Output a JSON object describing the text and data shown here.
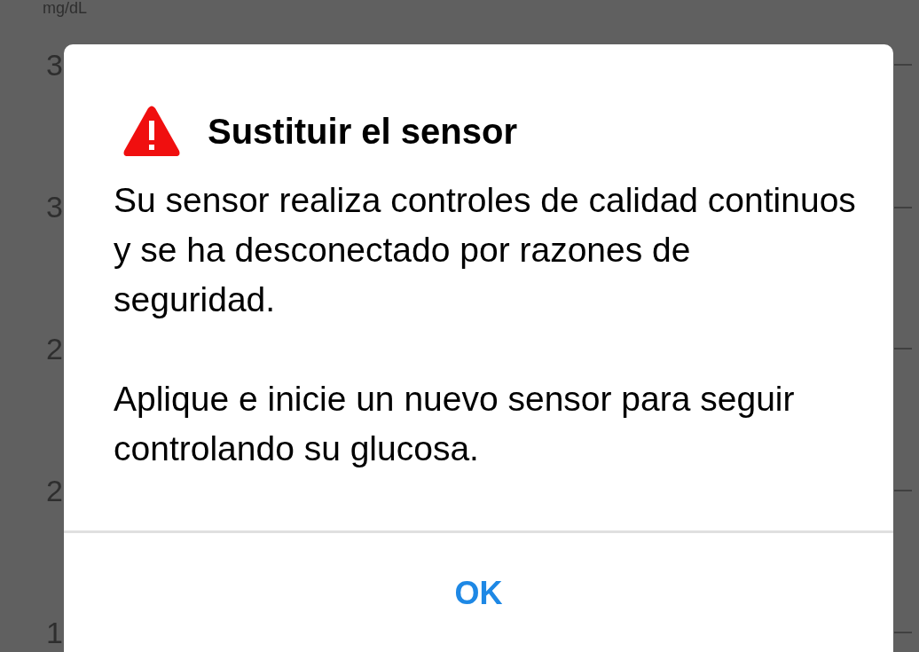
{
  "chart_background": {
    "unit": "mg/dL",
    "axis_labels": [
      "3",
      "3",
      "2",
      "2",
      "1"
    ]
  },
  "dialog": {
    "title": "Sustituir el sensor",
    "paragraphs": [
      "Su sensor realiza controles de calidad continuos y se ha desconectado por razones de seguridad.",
      "Aplique e inicie un nuevo sensor para seguir controlando su glucosa."
    ],
    "button": "OK"
  }
}
